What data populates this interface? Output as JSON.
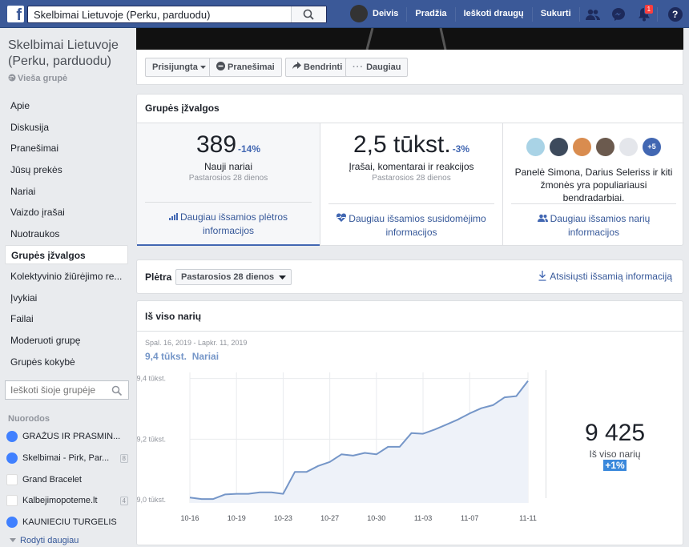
{
  "topbar": {
    "search_value": "Skelbimai Lietuvoje (Perku, parduodu)",
    "user_name": "Deivis",
    "home": "Pradžia",
    "find_friends": "Ieškoti draugų",
    "create": "Sukurti",
    "notification_count": "1",
    "help": "?"
  },
  "sidebar": {
    "group_name": "Skelbimai Lietuvoje (Perku, parduodu)",
    "group_type": "Vieša grupė",
    "items": [
      {
        "label": "Apie"
      },
      {
        "label": "Diskusija"
      },
      {
        "label": "Pranešimai"
      },
      {
        "label": "Jūsų prekės"
      },
      {
        "label": "Nariai"
      },
      {
        "label": "Vaizdo įrašai"
      },
      {
        "label": "Nuotraukos"
      },
      {
        "label": "Grupės įžvalgos"
      },
      {
        "label": "Kolektyvinio žiūrėjimo re..."
      },
      {
        "label": "Įvykiai"
      },
      {
        "label": "Failai"
      },
      {
        "label": "Moderuoti grupę"
      },
      {
        "label": "Grupės kokybė"
      }
    ],
    "search_placeholder": "Ieškoti šioje grupėje",
    "shortcuts_title": "Nuorodos",
    "shortcuts": [
      {
        "label": "GRAŽŪS IR PRASMIN...",
        "count": ""
      },
      {
        "label": "Skelbimai - Pirk, Par...",
        "count": "8"
      },
      {
        "label": "Grand Bracelet",
        "count": ""
      },
      {
        "label": "Kalbejimopoteme.lt",
        "count": "4"
      },
      {
        "label": "KAUNIECIU TURGELIS",
        "count": ""
      }
    ],
    "show_more": "Rodyti daugiau"
  },
  "actions": {
    "joined": "Prisijungta",
    "notifications": "Pranešimai",
    "share": "Bendrinti",
    "more": "Daugiau"
  },
  "insights": {
    "title": "Grupės įžvalgos",
    "growth": {
      "value": "389",
      "change": "-14%",
      "label": "Nauji nariai",
      "period": "Pastarosios 28 dienos",
      "link": "Daugiau išsamios plėtros informacijos"
    },
    "engagement": {
      "value": "2,5 tūkst.",
      "change": "-3%",
      "label": "Įrašai, komentarai ir reakcijos",
      "period": "Pastarosios 28 dienos",
      "link": "Daugiau išsamios susidomėjimo informacijos"
    },
    "members": {
      "more_count": "+5",
      "text": "Panelė Simona, Darius Seleriss ir kiti žmonės yra populiariausi bendradarbiai.",
      "link": "Daugiau išsamios narių informacijos"
    }
  },
  "growth_bar": {
    "title": "Plėtra",
    "period_select": "Pastarosios 28 dienos",
    "download": "Atsisiųsti išsamią informaciją"
  },
  "total_members": {
    "title": "Iš viso narių",
    "date_range": "Spal. 16, 2019 - Lapkr. 11, 2019",
    "summary_value": "9,4 tūkst.",
    "summary_label": "Nariai",
    "big_value": "9 425",
    "big_label": "Iš viso narių",
    "big_change": "+1%"
  },
  "chart_data": {
    "type": "area",
    "x_ticks": [
      "10-16",
      "10-19",
      "10-23",
      "10-27",
      "10-30",
      "11-03",
      "11-07",
      "11-11"
    ],
    "y_ticks": [
      "9,4 tūkst.",
      "9,2 tūkst.",
      "9,0 tūkst."
    ],
    "y_tick_values": [
      9400,
      9200,
      9000
    ],
    "ylim": [
      8990,
      9420
    ],
    "series": [
      {
        "values": [
          9008,
          9003,
          9003,
          9018,
          9020,
          9020,
          9025,
          9025,
          9020,
          9092,
          9092,
          9112,
          9125,
          9150,
          9146,
          9155,
          9150,
          9175,
          9175,
          9220,
          9218,
          9232,
          9248,
          9265,
          9285,
          9302,
          9312,
          9338,
          9342,
          9392
        ]
      }
    ],
    "color": "#7596c8",
    "fill": "#eef2f9",
    "grid": true
  }
}
